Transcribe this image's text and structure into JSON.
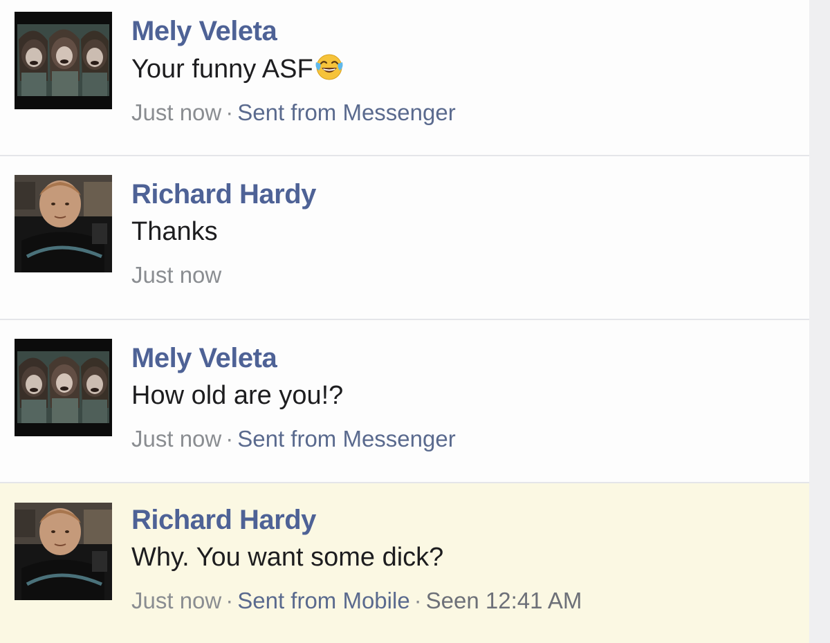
{
  "messages": [
    {
      "name": "Mely Veleta",
      "text": "Your funny ASF",
      "emoji": "face-with-tears-of-joy",
      "time": "Just now",
      "source": "Sent from Messenger",
      "avatar": "group-photo-three-girls"
    },
    {
      "name": "Richard Hardy",
      "text": "Thanks",
      "time": "Just now",
      "avatar": "boy-photo"
    },
    {
      "name": "Mely Veleta",
      "text": "How old are you!?",
      "time": "Just now",
      "source": "Sent from Messenger",
      "avatar": "group-photo-three-girls"
    },
    {
      "name": "Richard Hardy",
      "text": "Why. You want some dick?",
      "time": "Just now",
      "source": "Sent from Mobile",
      "seen": "Seen 12:41 AM",
      "avatar": "boy-photo",
      "highlighted": true
    }
  ],
  "meta": {
    "separator": "·"
  },
  "colors": {
    "name": "#4e6296",
    "meta": "#8a8d91",
    "highlight_bg": "#fbf8e3"
  }
}
